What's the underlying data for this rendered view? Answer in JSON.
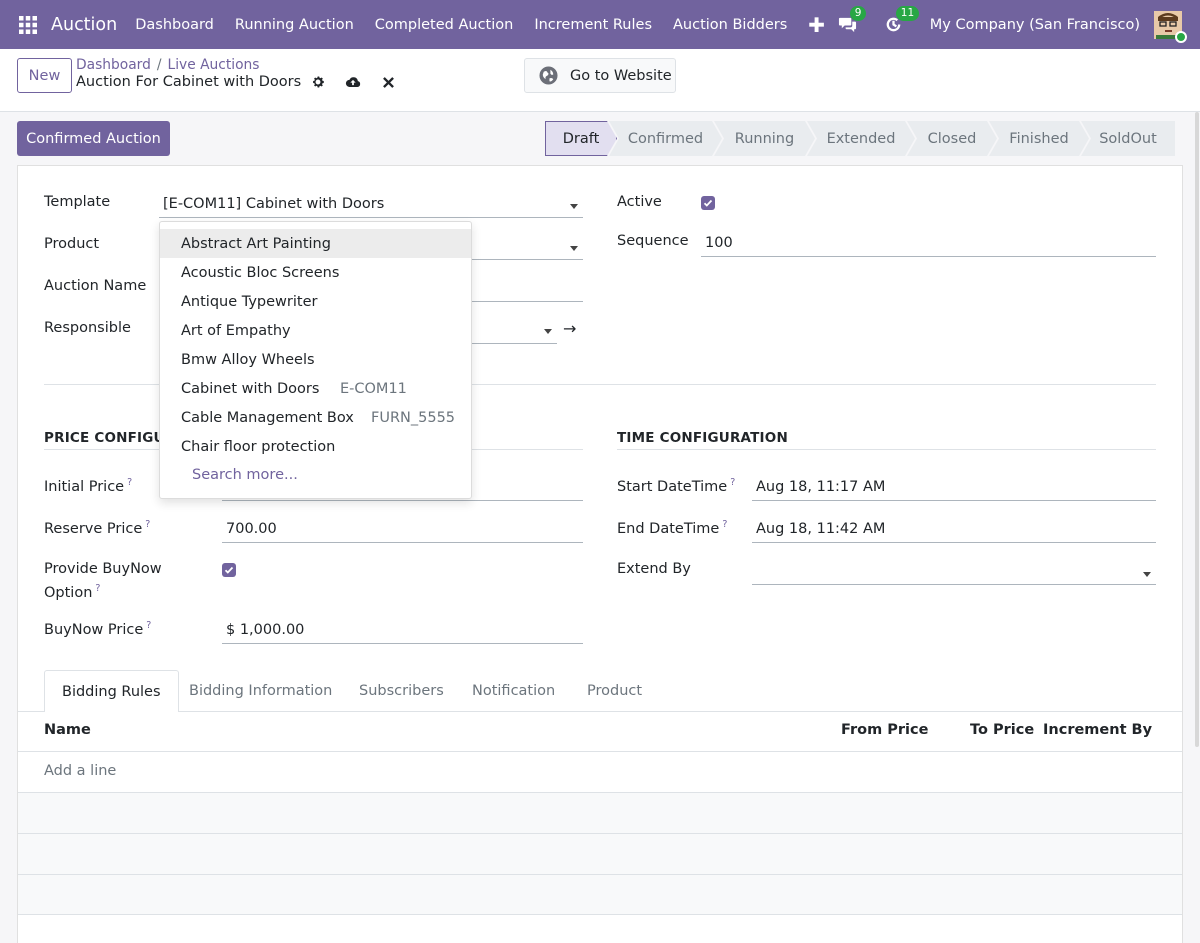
{
  "topnav": {
    "brand": "Auction",
    "menu": [
      "Dashboard",
      "Running Auction",
      "Completed Auction",
      "Increment Rules",
      "Auction Bidders"
    ],
    "messages_count": "9",
    "activities_count": "11",
    "company": "My Company (San Francisco)"
  },
  "control": {
    "new_label": "New",
    "breadcrumb": [
      "Dashboard",
      "Live Auctions"
    ],
    "record_title": "Auction For Cabinet with Doors",
    "website_label": "Go to Website"
  },
  "statusbar": {
    "confirm_label": "Confirmed Auction",
    "stages": [
      "Draft",
      "Confirmed",
      "Running",
      "Extended",
      "Closed",
      "Finished",
      "SoldOut"
    ],
    "active_stage": "Draft"
  },
  "form": {
    "template_label": "Template",
    "template_value": "[E-COM11] Cabinet with Doors",
    "product_label": "Product",
    "auction_name_label": "Auction Name",
    "responsible_label": "Responsible",
    "active_label": "Active",
    "active_checked": true,
    "sequence_label": "Sequence",
    "sequence_value": "100",
    "price_section": "PRICE CONFIGURATION",
    "price_section_visible": "PRICE CONFIGUR",
    "initial_price_label": "Initial Price",
    "reserve_price_label": "Reserve Price",
    "reserve_price_value": "700.00",
    "buynow_option_label_1": "Provide BuyNow",
    "buynow_option_label_2": "Option",
    "buynow_checked": true,
    "buynow_price_label": "BuyNow Price",
    "buynow_price_value": "$ 1,000.00",
    "time_section": "TIME CONFIGURATION",
    "start_label": "Start DateTime",
    "start_value": "Aug 18, 11:17 AM",
    "end_label": "End DateTime",
    "end_value": "Aug 18, 11:42 AM",
    "extend_label": "Extend By",
    "help_mark": "?"
  },
  "tabs": [
    "Bidding Rules",
    "Bidding Information",
    "Subscribers",
    "Notification",
    "Product"
  ],
  "table": {
    "columns": [
      "Name",
      "From Price",
      "To Price",
      "Increment By"
    ],
    "add_line": "Add a line"
  },
  "dropdown": {
    "items": [
      {
        "name": "Abstract Art Painting",
        "code": ""
      },
      {
        "name": "Acoustic Bloc Screens",
        "code": ""
      },
      {
        "name": "Antique Typewriter",
        "code": ""
      },
      {
        "name": "Art of Empathy",
        "code": ""
      },
      {
        "name": "Bmw Alloy Wheels",
        "code": ""
      },
      {
        "name": "Cabinet with Doors",
        "code": "E-COM11"
      },
      {
        "name": "Cable Management Box",
        "code": "FURN_5555"
      },
      {
        "name": "Chair floor protection",
        "code": ""
      }
    ],
    "search_more": "Search more..."
  },
  "colors": {
    "brand": "#71639e",
    "badge": "#28a745"
  }
}
